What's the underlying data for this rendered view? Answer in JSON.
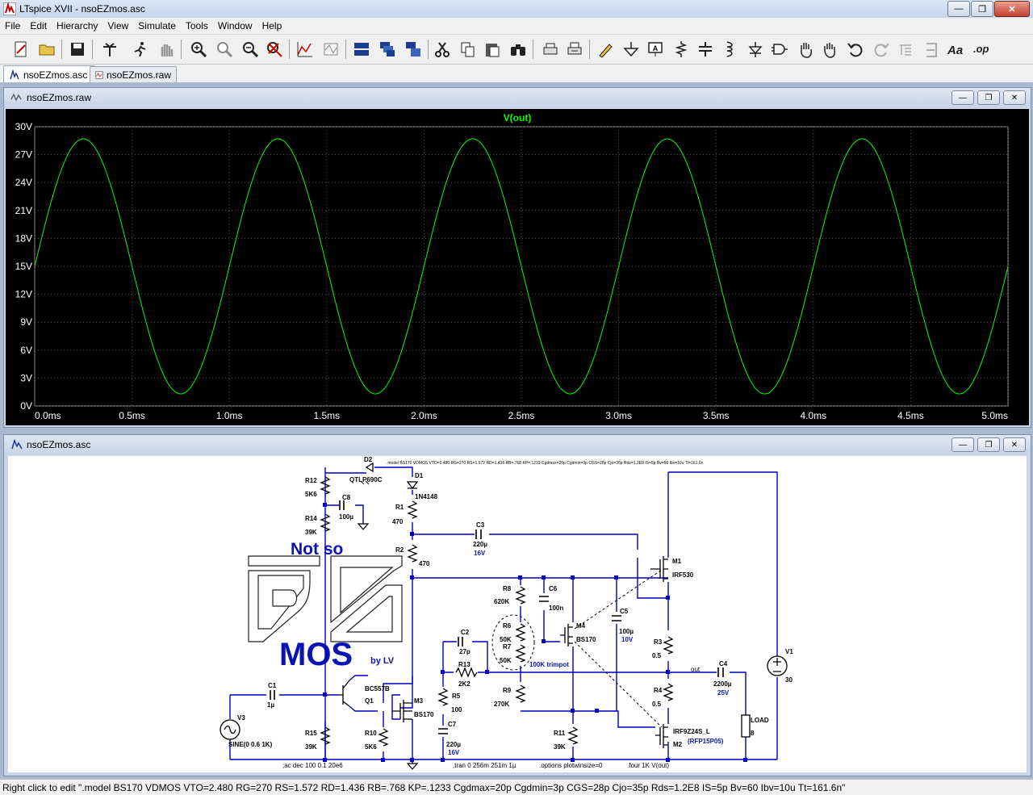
{
  "window": {
    "title": "LTspice XVII - nsoEZmos.asc"
  },
  "menu": [
    "File",
    "Edit",
    "Hierarchy",
    "View",
    "Simulate",
    "Tools",
    "Window",
    "Help"
  ],
  "tabs": [
    {
      "label": "nsoEZmos.asc",
      "active": true
    },
    {
      "label": "nsoEZmos.raw",
      "active": false
    }
  ],
  "waveform": {
    "window_title": "nsoEZmos.raw",
    "trace_name": "V(out)",
    "trace_color": "#00ff00",
    "chart_data": {
      "type": "line",
      "title": "V(out)",
      "xlabel": "",
      "ylabel": "",
      "xlim": [
        0,
        5
      ],
      "ylim": [
        0,
        30
      ],
      "x_unit": "ms",
      "y_unit": "V",
      "y_ticks": [
        "0V",
        "3V",
        "6V",
        "9V",
        "12V",
        "15V",
        "18V",
        "21V",
        "24V",
        "27V",
        "30V"
      ],
      "x_ticks": [
        "0.0ms",
        "0.5ms",
        "1.0ms",
        "1.5ms",
        "2.0ms",
        "2.5ms",
        "3.0ms",
        "3.5ms",
        "4.0ms",
        "4.5ms",
        "5.0ms"
      ],
      "series": [
        {
          "name": "V(out)",
          "frequency_khz": 1,
          "offset_v": 15.0,
          "amplitude_v": 13.7
        }
      ]
    }
  },
  "schematic": {
    "window_title": "nsoEZmos.asc",
    "wire_color": "#0000c0",
    "logo": {
      "line1": "Not  so",
      "line2": "MOS",
      "by": "by LV"
    },
    "model_line": ".model BS170 VDMOS VTO=2.480 RG=270 RS=1.572 RD=1.436 RB=.768 KP=.1233 Cgdmax=20p Cgdmin=3p CGS=28p Cjo=35p Rds=1.2E8 IS=5p Bv=60 Ibv=10u Tt=161.6n",
    "components": {
      "D2": "D2",
      "D2v": "QTLP690C",
      "D1": "D1",
      "D1v": "1N4148",
      "R12": "R12",
      "R12v": "5K6",
      "R14": "R14",
      "R14v": "39K",
      "C8": "C8",
      "C8v": "100µ",
      "R1": "R1",
      "R1v": "470",
      "R2": "R2",
      "R2v": "470",
      "C3": "C3",
      "C3v": "220µ",
      "C3r": "16V",
      "M1": "M1",
      "M1v": "IRF530",
      "R8": "R8",
      "R8v": "620K",
      "C6": "C6",
      "C6v": "100n",
      "R6": "R6",
      "R6v": "50K",
      "R7": "R7",
      "R7v": "50K",
      "trimpot": "100K trimpot",
      "M4": "M4",
      "M4v": "BS170",
      "C5": "C5",
      "C5v": "100µ",
      "C5r": "10V",
      "R3": "R3",
      "R3v": "0.5",
      "R4": "R4",
      "R4v": "0.5",
      "out": "out",
      "C4": "C4",
      "C4v": "2200µ",
      "C4r": "25V",
      "V1": "V1",
      "V1v": "30",
      "LOAD": "LOAD",
      "LOADv": "8",
      "C2": "C2",
      "C2v": "27p",
      "R13": "R13",
      "R13v": "2K2",
      "R5": "R5",
      "R5v": "100",
      "C7": "C7",
      "C7v": "220µ",
      "C7r": "16V",
      "R9": "R9",
      "R9v": "270K",
      "C1": "C1",
      "C1v": "1µ",
      "Q1": "Q1",
      "Q1v": "BC557B",
      "M3": "M3",
      "M3v": "BS170",
      "V3": "V3",
      "V3v": "SINE(0 0.6 1K)",
      "R15": "R15",
      "R15v": "39K",
      "R10": "R10",
      "R10v": "5K6",
      "R11": "R11",
      "R11v": "39K",
      "M2": "M2",
      "M2v": "IRF9Z24S_L",
      "M2alt": "(RFP15P05)"
    },
    "directives": {
      "ac": ";ac dec 100 0.1 20e6",
      "tran": ".tran 0 256m 251m 1µ",
      "options": ".options plotwinsize=0",
      "four": ".four 1K V(out)"
    }
  },
  "status": "Right click to edit \".model BS170 VDMOS VTO=2.480 RG=270 RS=1.572 RD=1.436 RB=.768 KP=.1233 Cgdmax=20p Cgdmin=3p CGS=28p Cjo=35p Rds=1.2E8 IS=5p Bv=60 Ibv=10u Tt=161.6n\""
}
